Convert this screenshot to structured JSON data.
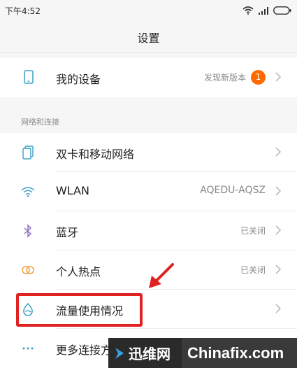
{
  "status_bar": {
    "time": "下午4:52"
  },
  "header": {
    "title": "设置"
  },
  "device_row": {
    "label": "我的设备",
    "value": "发现新版本",
    "badge": "1"
  },
  "network_section": {
    "header": "网络和连接",
    "items": [
      {
        "label": "双卡和移动网络",
        "value": "",
        "icon": "sim-cards-icon"
      },
      {
        "label": "WLAN",
        "value": "AQEDU-AQSZ",
        "icon": "wifi-icon"
      },
      {
        "label": "蓝牙",
        "value": "已关闭",
        "icon": "bluetooth-icon"
      },
      {
        "label": "个人热点",
        "value": "已关闭",
        "icon": "hotspot-icon"
      },
      {
        "label": "流量使用情况",
        "value": "",
        "icon": "data-usage-icon"
      },
      {
        "label": "更多连接方式",
        "value": "",
        "icon": "more-icon"
      }
    ]
  },
  "annotation_color": "#e02222",
  "watermark": {
    "logo": "迅维网",
    "site": "Chinafix.com"
  }
}
